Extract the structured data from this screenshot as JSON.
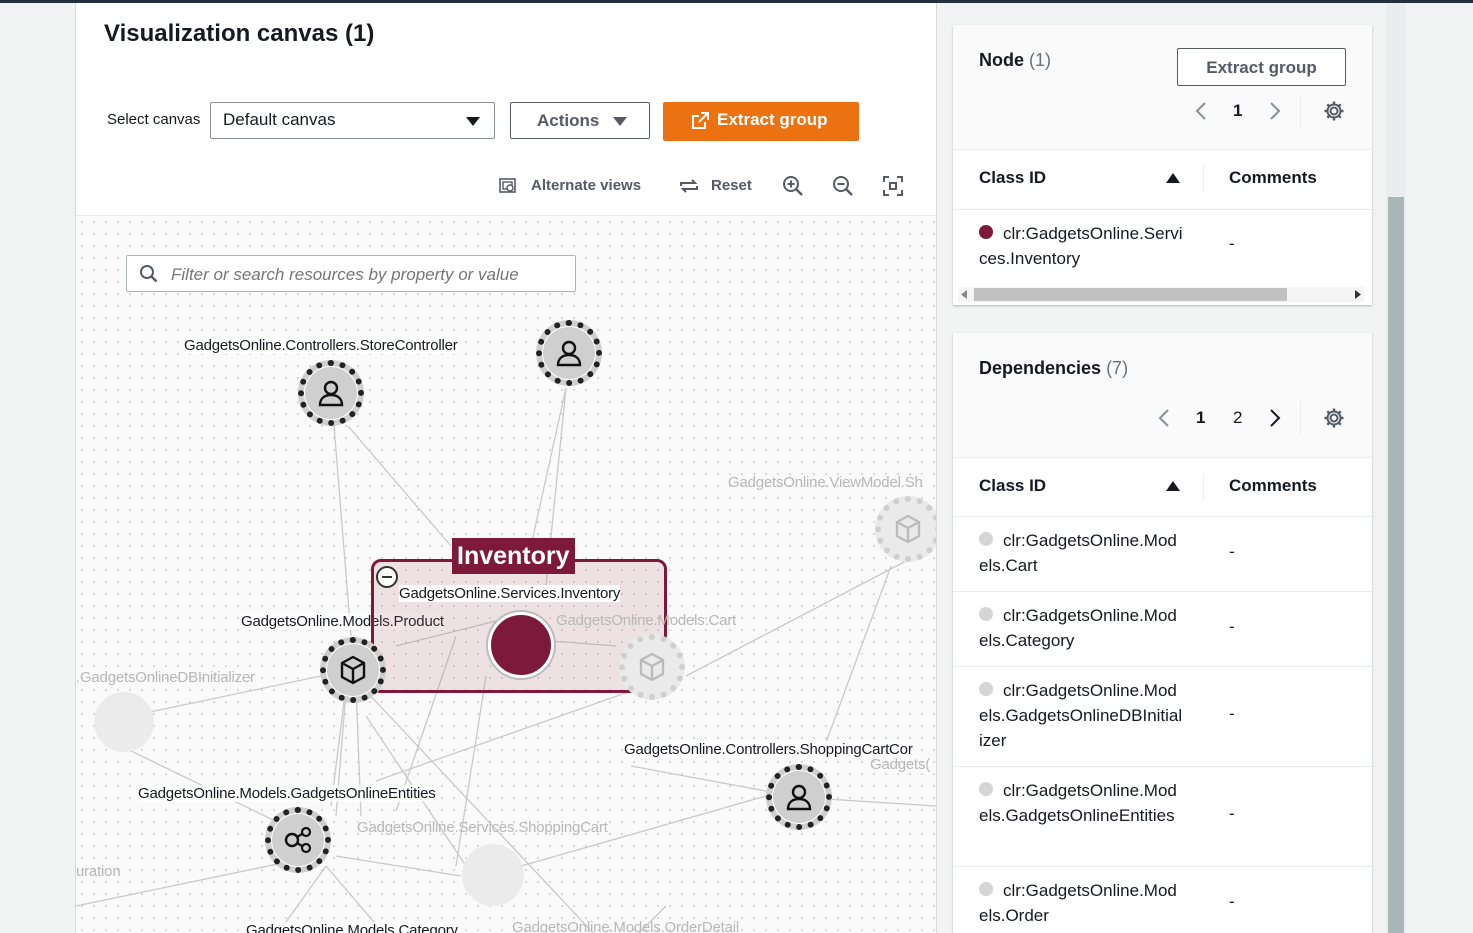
{
  "canvas": {
    "title": "Visualization canvas (1)",
    "select_label": "Select canvas",
    "select_value": "Default canvas",
    "actions_label": "Actions",
    "extract_label": "Extract group",
    "alt_views_label": "Alternate views",
    "reset_label": "Reset",
    "search_placeholder": "Filter or search resources by property or value",
    "group_tag": "Inventory",
    "labels": {
      "store_controller": "GadgetsOnline.Controllers.StoreController",
      "services_inventory": "GadgetsOnline.Services.Inventory",
      "models_product": "GadgetsOnline.Models.Product",
      "models_cart": "GadgetsOnline.Models.Cart",
      "viewmodel": "GadgetsOnline.ViewModel.Sh",
      "db_initializer": ".GadgetsOnlineDBInitializer",
      "shoppingcart_controller": "GadgetsOnline.Controllers.ShoppingCartCor",
      "gadgets_partial": "Gadgets(",
      "models_entities": "GadgetsOnline.Models.GadgetsOnlineEntities",
      "services_shoppingcart": "GadgetsOnline.Services.ShoppingCart",
      "configuration": "uration",
      "models_category": "GadgetsOnline.Models.Category",
      "models_orderdetail": "GadgetsOnline.Models.OrderDetail"
    },
    "icons": [
      "search-icon",
      "person-icon",
      "cube-icon",
      "share-nodes-icon",
      "zoom-in-icon",
      "zoom-out-icon",
      "fit-icon",
      "refresh-icon",
      "external-link-icon",
      "alternate-views-icon"
    ],
    "accent_color": "#ec7211",
    "group_color": "#7d1a3c"
  },
  "node_panel": {
    "title": "Node",
    "count": "(1)",
    "extract_label": "Extract group",
    "page": "1",
    "col_class_id": "Class ID",
    "col_comments": "Comments",
    "rows": [
      {
        "class_id": "clr:GadgetsOnline.Services.Inventory",
        "comment": "-",
        "dot_color": "#7d1a3c"
      }
    ]
  },
  "deps_panel": {
    "title": "Dependencies",
    "count": "(7)",
    "pages": [
      "1",
      "2"
    ],
    "col_class_id": "Class ID",
    "col_comments": "Comments",
    "rows": [
      {
        "class_id": "clr:GadgetsOnline.Models.Cart",
        "comment": "-"
      },
      {
        "class_id": "clr:GadgetsOnline.Models.Category",
        "comment": "-"
      },
      {
        "class_id": "clr:GadgetsOnline.Models.GadgetsOnlineDBInitializer",
        "comment": "-"
      },
      {
        "class_id": "clr:GadgetsOnline.Models.GadgetsOnlineEntities",
        "comment": "-"
      },
      {
        "class_id": "clr:GadgetsOnline.Models.Order",
        "comment": "-"
      }
    ],
    "dot_color": "#d5d5d5"
  }
}
